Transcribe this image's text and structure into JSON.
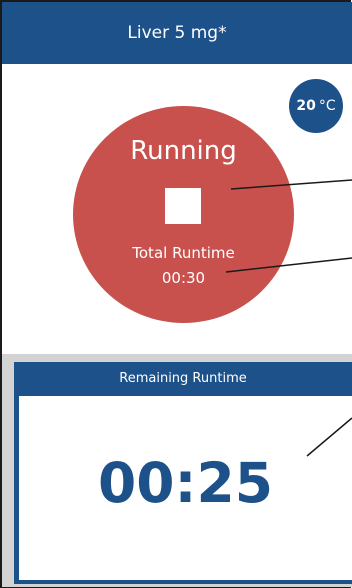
{
  "header": {
    "title": "Liver 5 mg*"
  },
  "temperature": {
    "value": "20",
    "unit": "°C"
  },
  "status": {
    "label": "Running",
    "stop_icon": "stop-square-icon",
    "total_runtime_label": "Total Runtime",
    "total_runtime_value": "00:30"
  },
  "remaining": {
    "label": "Remaining Runtime",
    "value": "00:25"
  },
  "colors": {
    "primary_blue": "#1d5189",
    "status_red": "#c9514d",
    "band_gray": "#d3d3d3"
  }
}
